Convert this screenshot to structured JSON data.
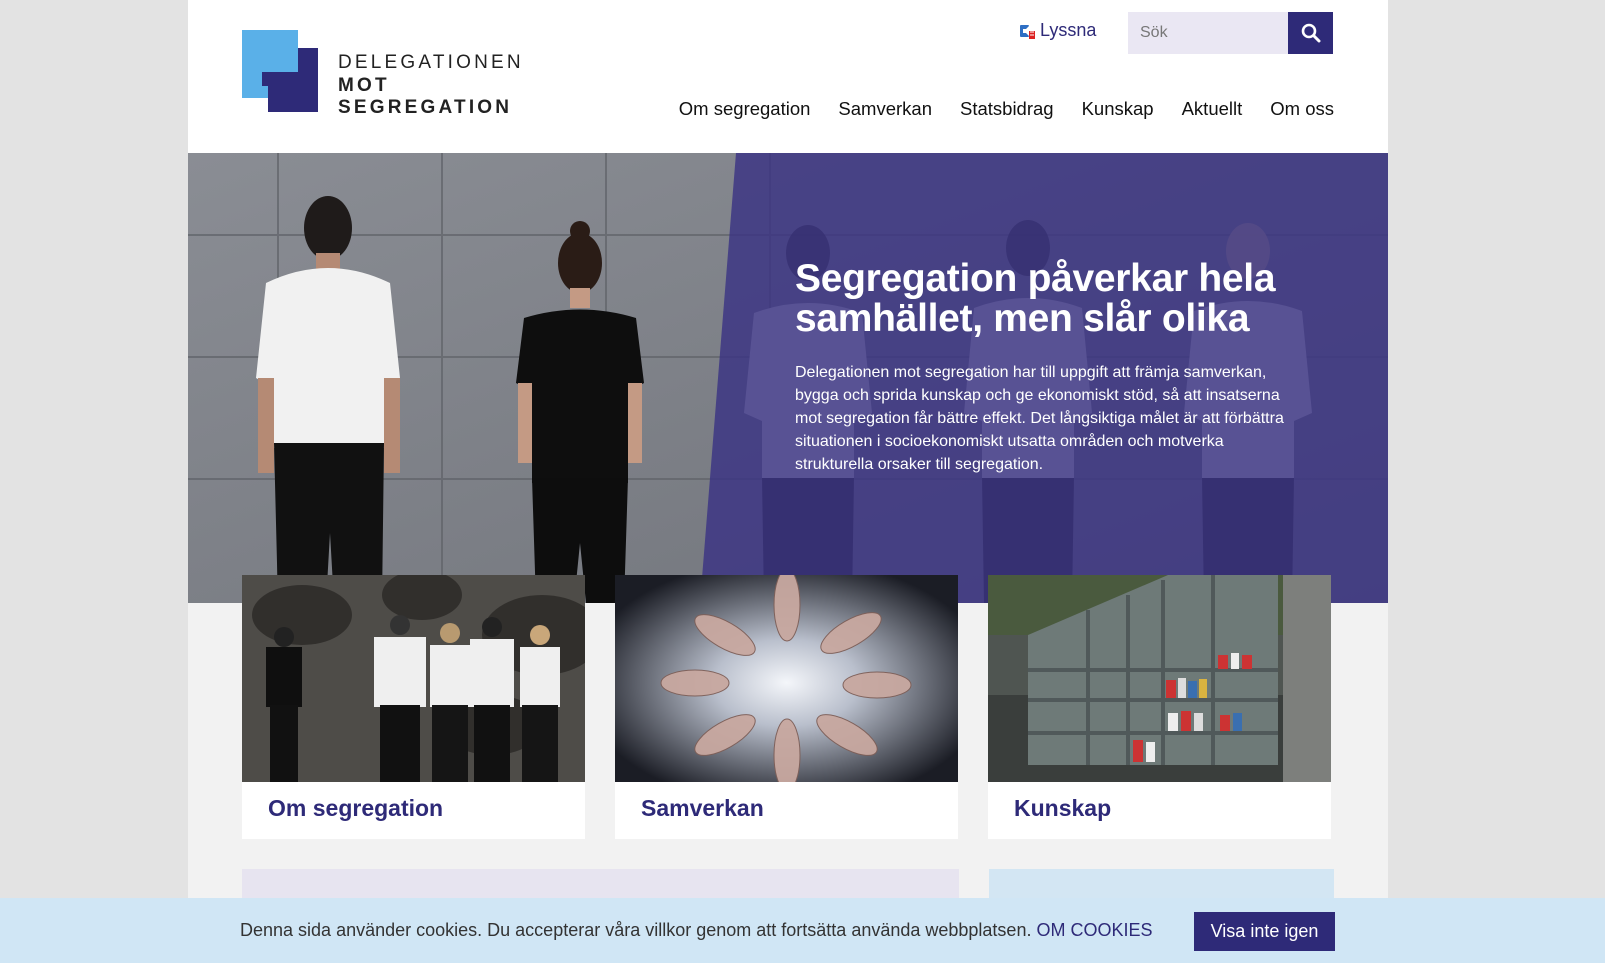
{
  "brand": {
    "name_line1": "DELEGATIONEN",
    "name_line2": "MOT SEGREGATION"
  },
  "header": {
    "listen_label": "Lyssna",
    "search_placeholder": "Sök"
  },
  "nav": {
    "items": [
      "Om segregation",
      "Samverkan",
      "Statsbidrag",
      "Kunskap",
      "Aktuellt",
      "Om oss"
    ]
  },
  "hero": {
    "title": "Segregation påverkar hela samhället, men slår olika",
    "text": "Delegationen mot segregation har till uppgift att främja samverkan, bygga och sprida kunskap och ge ekonomiskt stöd, så att insatserna mot segregation får bättre effekt. Det långsiktiga målet är att förbättra situationen i socioekonomiskt utsatta områden och motverka strukturella orsaker till segregation."
  },
  "cards": [
    {
      "title": "Om segregation"
    },
    {
      "title": "Samverkan"
    },
    {
      "title": "Kunskap"
    }
  ],
  "cookie": {
    "text": "Denna sida använder cookies. Du accepterar våra villkor genom att fortsätta använda webbplatsen.",
    "link": "OM COOKIES",
    "button": "Visa inte igen"
  },
  "colors": {
    "brand_purple": "#2e2a78",
    "logo_blue": "#5ab0e8",
    "cookie_bar": "#d0e6f5"
  }
}
